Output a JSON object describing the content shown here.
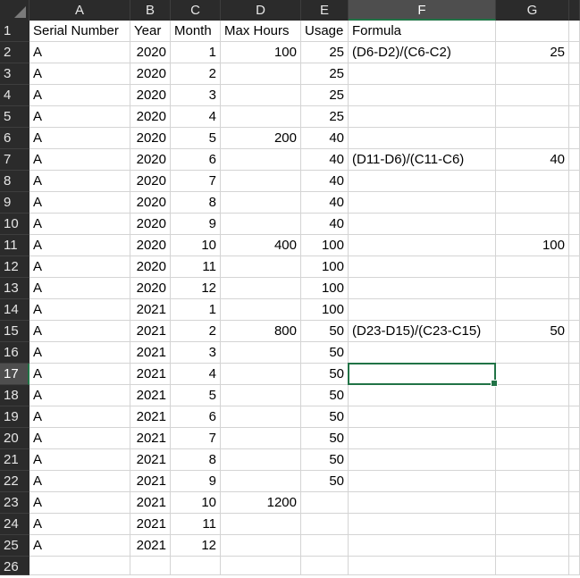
{
  "columns": [
    "A",
    "B",
    "C",
    "D",
    "E",
    "F",
    "G"
  ],
  "selected_column": "F",
  "selected_row": 17,
  "rows": [
    {
      "n": 1,
      "cells": [
        "Serial Number",
        "Year",
        "Month",
        "Max Hours",
        "Usage",
        "Formula",
        ""
      ]
    },
    {
      "n": 2,
      "cells": [
        "A",
        "2020",
        "1",
        "100",
        "25",
        "(D6-D2)/(C6-C2)",
        "25"
      ]
    },
    {
      "n": 3,
      "cells": [
        "A",
        "2020",
        "2",
        "",
        "25",
        "",
        ""
      ]
    },
    {
      "n": 4,
      "cells": [
        "A",
        "2020",
        "3",
        "",
        "25",
        "",
        ""
      ]
    },
    {
      "n": 5,
      "cells": [
        "A",
        "2020",
        "4",
        "",
        "25",
        "",
        ""
      ]
    },
    {
      "n": 6,
      "cells": [
        "A",
        "2020",
        "5",
        "200",
        "40",
        "",
        ""
      ]
    },
    {
      "n": 7,
      "cells": [
        "A",
        "2020",
        "6",
        "",
        "40",
        "(D11-D6)/(C11-C6)",
        "40"
      ]
    },
    {
      "n": 8,
      "cells": [
        "A",
        "2020",
        "7",
        "",
        "40",
        "",
        ""
      ]
    },
    {
      "n": 9,
      "cells": [
        "A",
        "2020",
        "8",
        "",
        "40",
        "",
        ""
      ]
    },
    {
      "n": 10,
      "cells": [
        "A",
        "2020",
        "9",
        "",
        "40",
        "",
        ""
      ]
    },
    {
      "n": 11,
      "cells": [
        "A",
        "2020",
        "10",
        "400",
        "100",
        "",
        "100"
      ]
    },
    {
      "n": 12,
      "cells": [
        "A",
        "2020",
        "11",
        "",
        "100",
        "",
        ""
      ]
    },
    {
      "n": 13,
      "cells": [
        "A",
        "2020",
        "12",
        "",
        "100",
        "",
        ""
      ]
    },
    {
      "n": 14,
      "cells": [
        "A",
        "2021",
        "1",
        "",
        "100",
        "",
        ""
      ]
    },
    {
      "n": 15,
      "cells": [
        "A",
        "2021",
        "2",
        "800",
        "50",
        "(D23-D15)/(C23-C15)",
        "50"
      ]
    },
    {
      "n": 16,
      "cells": [
        "A",
        "2021",
        "3",
        "",
        "50",
        "",
        ""
      ]
    },
    {
      "n": 17,
      "cells": [
        "A",
        "2021",
        "4",
        "",
        "50",
        "",
        ""
      ]
    },
    {
      "n": 18,
      "cells": [
        "A",
        "2021",
        "5",
        "",
        "50",
        "",
        ""
      ]
    },
    {
      "n": 19,
      "cells": [
        "A",
        "2021",
        "6",
        "",
        "50",
        "",
        ""
      ]
    },
    {
      "n": 20,
      "cells": [
        "A",
        "2021",
        "7",
        "",
        "50",
        "",
        ""
      ]
    },
    {
      "n": 21,
      "cells": [
        "A",
        "2021",
        "8",
        "",
        "50",
        "",
        ""
      ]
    },
    {
      "n": 22,
      "cells": [
        "A",
        "2021",
        "9",
        "",
        "50",
        "",
        ""
      ]
    },
    {
      "n": 23,
      "cells": [
        "A",
        "2021",
        "10",
        "1200",
        "",
        "",
        ""
      ]
    },
    {
      "n": 24,
      "cells": [
        "A",
        "2021",
        "11",
        "",
        "",
        "",
        ""
      ]
    },
    {
      "n": 25,
      "cells": [
        "A",
        "2021",
        "12",
        "",
        "",
        "",
        ""
      ]
    },
    {
      "n": 26,
      "cells": [
        "",
        "",
        "",
        "",
        "",
        "",
        ""
      ]
    }
  ]
}
